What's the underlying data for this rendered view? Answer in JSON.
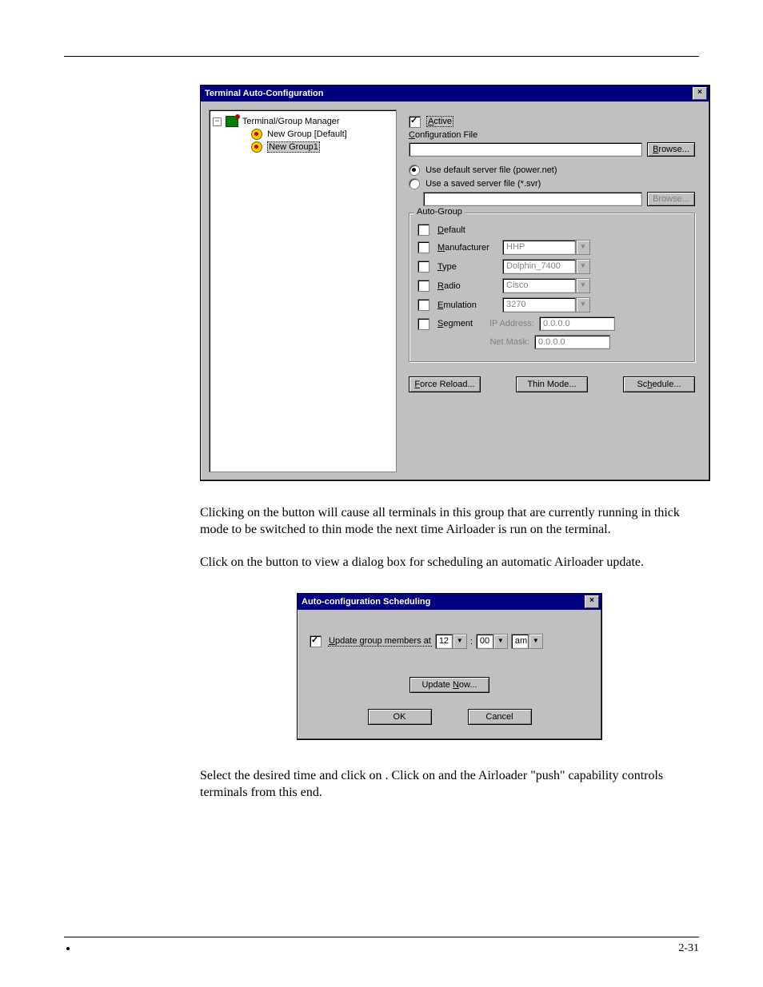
{
  "window1": {
    "title": "Terminal Auto-Configuration",
    "close_glyph": "×",
    "tree": {
      "expand_glyph": "−",
      "root": "Terminal/Group Manager",
      "item1": "New Group [Default]",
      "item2": "New Group1"
    },
    "active_label": "Active",
    "config_file_label": "Configuration File",
    "browse_label": "Browse...",
    "radio1": "Use default server file (power.net)",
    "radio2": "Use a saved server file (*.svr)",
    "auto_group": {
      "title": "Auto-Group",
      "default_label": "Default",
      "manufacturer_label": "Manufacturer",
      "manufacturer_val": "HHP",
      "type_label": "Type",
      "type_val": "Dolphin_7400",
      "radio_label": "Radio",
      "radio_val": "Cisco",
      "emulation_label": "Emulation",
      "emulation_val": "3270",
      "segment_label": "Segment",
      "ip_label": "IP Address:",
      "ip_val": "0.0.0.0",
      "mask_label": "Net Mask:",
      "mask_val": "0.0.0.0"
    },
    "force_reload": "Force Reload...",
    "thin_mode": "Thin Mode...",
    "schedule": "Schedule..."
  },
  "para1_a": "Clicking on the ",
  "para1_b": " button will cause all terminals in this group that are currently running in thick mode to be switched to thin mode the next time Airloader is run on the terminal.",
  "para2_a": "Click on the ",
  "para2_b": " button to view a dialog box for scheduling an automatic Airloader update.",
  "window2": {
    "title": "Auto-configuration Scheduling",
    "close_glyph": "×",
    "update_label": "Update group members at",
    "hour": "12",
    "minute": "00",
    "ampm": "am",
    "colon": ":",
    "update_now": "Update Now...",
    "ok": "OK",
    "cancel": "Cancel"
  },
  "para3_a": "Select the desired time and click on ",
  "para3_b": ". Click on ",
  "para3_c": " and the Airloader \"push\" capability controls terminals from this end.",
  "footer": {
    "left": "",
    "right": "2-31"
  }
}
